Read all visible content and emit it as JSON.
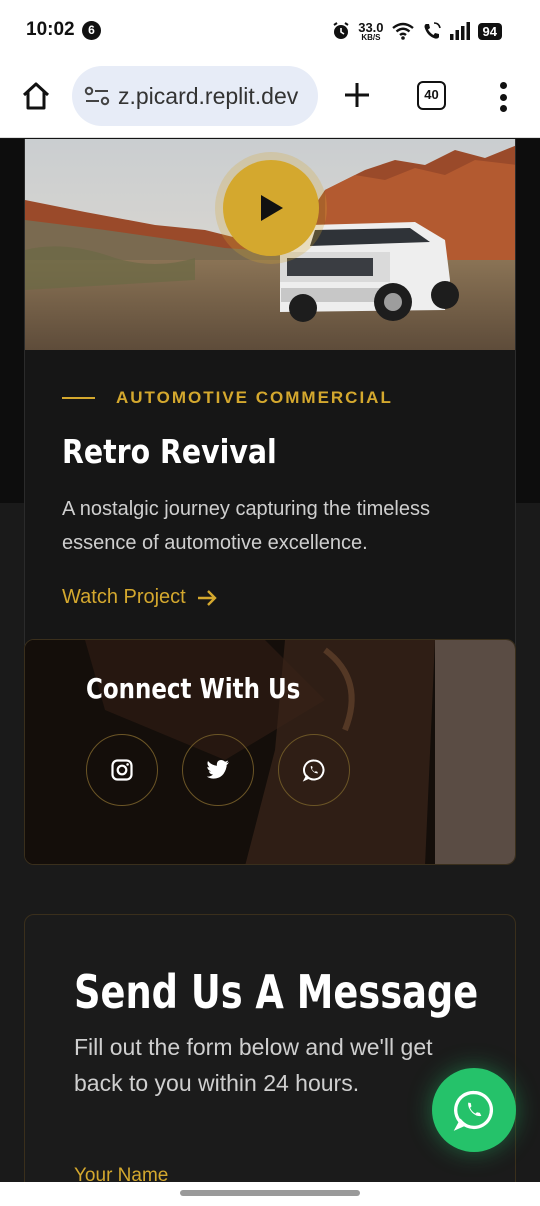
{
  "status_bar": {
    "time": "10:02",
    "notification_count": "6",
    "net_speed": "33.0",
    "net_unit": "KB/S",
    "battery": "94",
    "icons": [
      "alarm-icon",
      "wifi-icon",
      "wifi-call-icon",
      "signal-icon",
      "battery-icon"
    ]
  },
  "browser": {
    "url": "z.picard.replit.dev",
    "tab_count": "40",
    "icons": [
      "home-icon",
      "site-settings-icon",
      "new-tab-icon",
      "menu-icon"
    ]
  },
  "project": {
    "category": "AUTOMOTIVE COMMERCIAL",
    "title": "Retro Revival",
    "description": "A nostalgic journey capturing the timeless essence of automotive excellence.",
    "link_label": "Watch Project",
    "link_icon": "arrow-right-icon",
    "play_icon": "play-icon"
  },
  "connect": {
    "title": "Connect With Us",
    "socials": [
      "instagram-icon",
      "twitter-icon",
      "whatsapp-icon"
    ]
  },
  "message": {
    "title": "Send Us A Message",
    "description": "Fill out the form below and we'll get back to you within 24 hours.",
    "name_label": "Your Name"
  },
  "colors": {
    "accent": "#d4a82e",
    "background": "#1a1a1a",
    "whatsapp": "#25c26a"
  }
}
